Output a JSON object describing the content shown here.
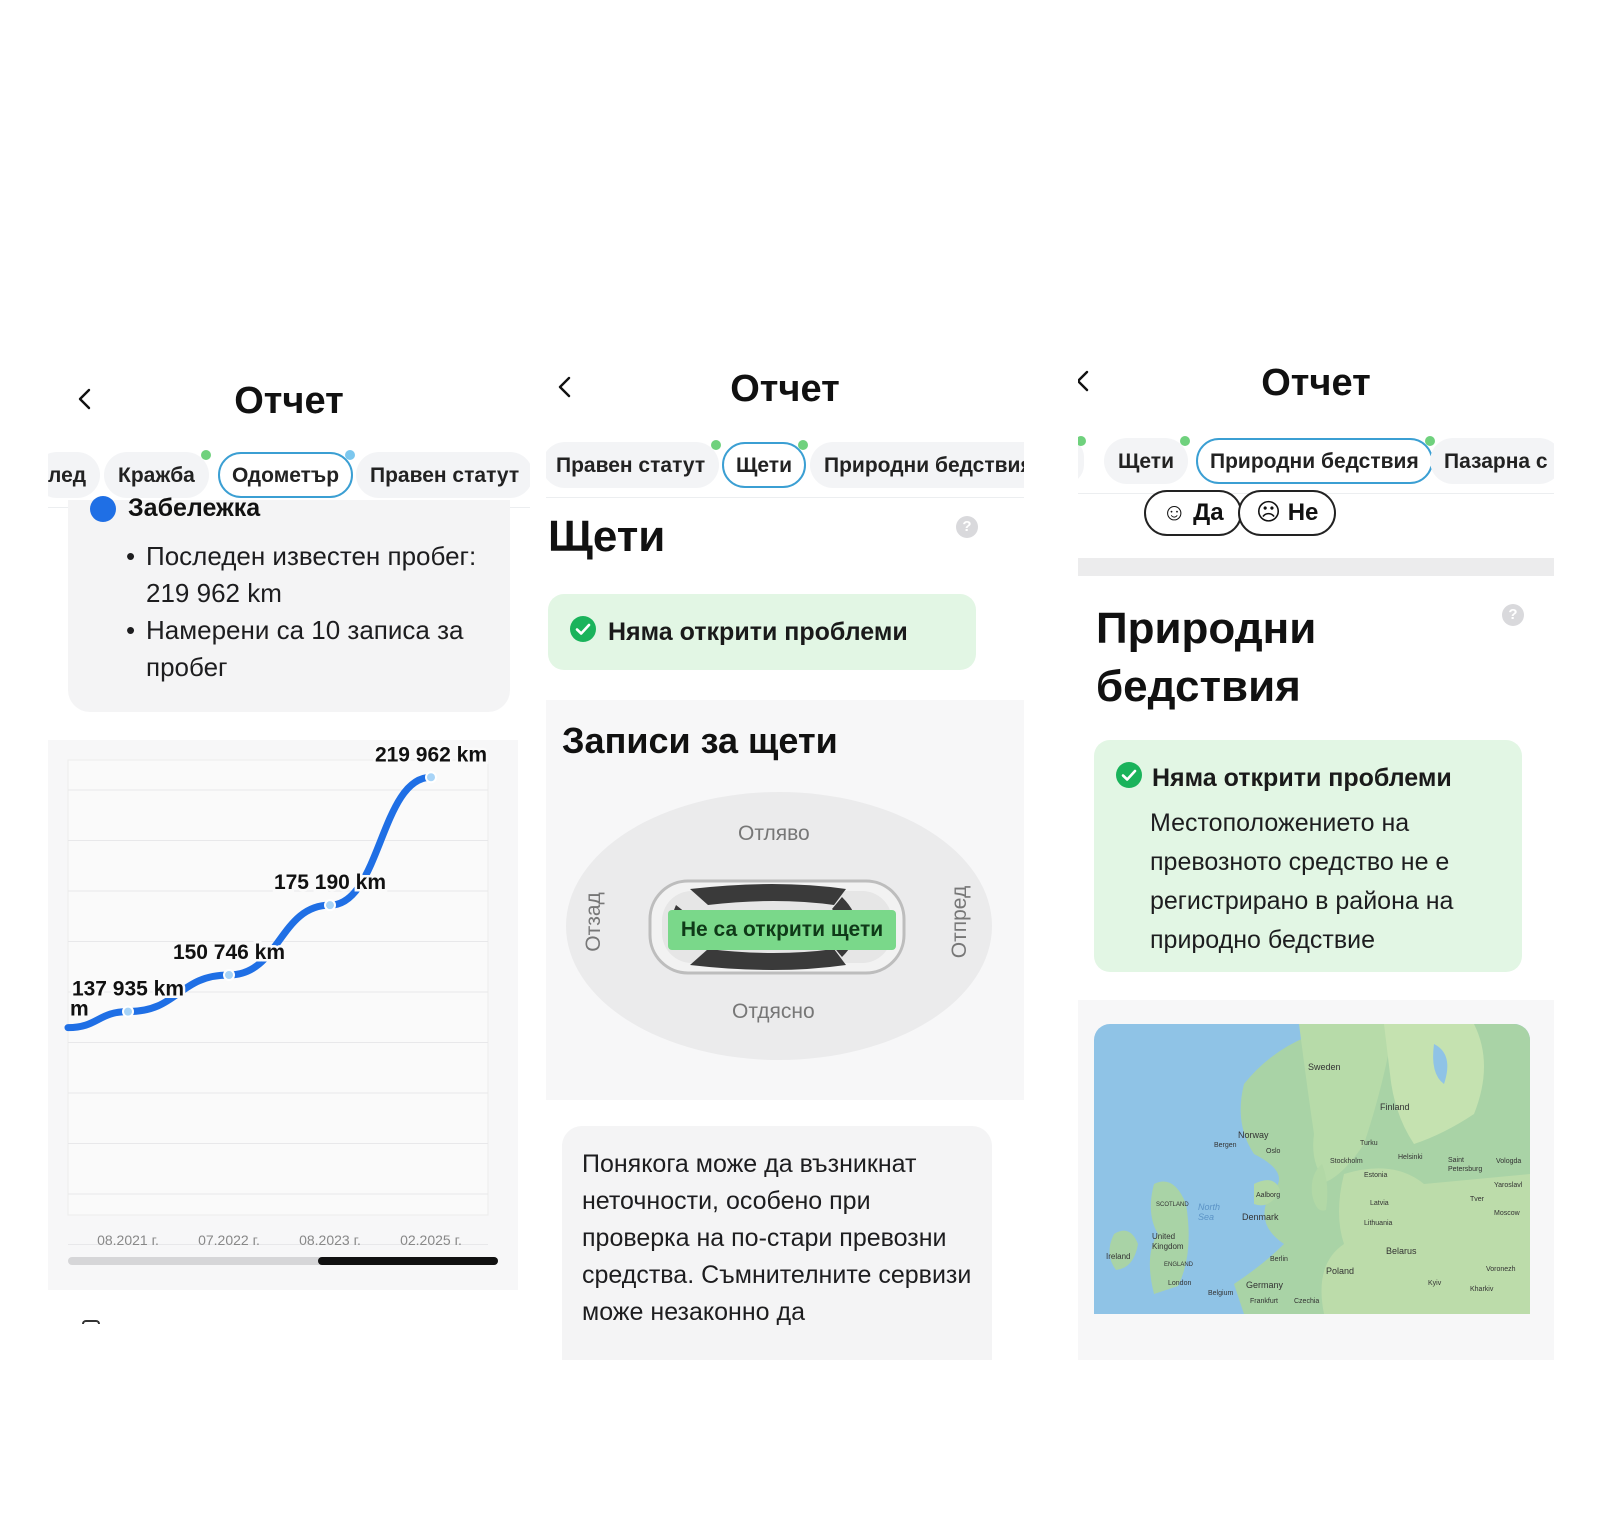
{
  "header": {
    "title": "Отчет"
  },
  "panel1": {
    "tabs": [
      {
        "label": "лед"
      },
      {
        "label": "Кражба"
      },
      {
        "label": "Одометър"
      },
      {
        "label": "Правен статут"
      }
    ],
    "note": {
      "title": "Забележка",
      "items": [
        "Последен известен пробег: 219 962 km",
        "Намерени са 10 записа за пробег"
      ]
    }
  },
  "chart_data": {
    "type": "line",
    "x": [
      "08.2021 г.",
      "07.2022 г.",
      "08.2023 г.",
      "02.2025 г."
    ],
    "series": [
      {
        "values": [
          137935,
          150746,
          175190,
          219962
        ],
        "labels": [
          "137 935 km",
          "150 746 km",
          "175 190 km",
          "219 962 km"
        ]
      }
    ],
    "partial_label": "m",
    "grid": true,
    "line_color": "#1f6fe5"
  },
  "panel2": {
    "tabs": [
      {
        "label": "Правен статут"
      },
      {
        "label": "Щети"
      },
      {
        "label": "Природни бедствия"
      }
    ],
    "section_title": "Щети",
    "status": "Няма открити проблеми",
    "records_title": "Записи за щети",
    "sides": {
      "left": "Отляво",
      "right": "Отдясно",
      "rear": "Отзад",
      "front": "Отпред"
    },
    "no_damage": "Не са открити щети",
    "disclaimer": "Понякога може да възникнат неточности, особено при проверка на по-стари превозни средства. Съмнителните сервизи може незаконно да"
  },
  "panel3": {
    "tabs": [
      {
        "label": "т"
      },
      {
        "label": "Щети"
      },
      {
        "label": "Природни бедствия"
      },
      {
        "label": "Пазарна с"
      }
    ],
    "yes": "☺ Да",
    "no": "☹ Не",
    "section_title_1": "Природни",
    "section_title_2": "бедствия",
    "status": "Няма открити проблеми",
    "status_text": "Местоположението на превозното средство не е регистрирано в района на природно бедствие",
    "map_labels": {
      "sweden": "Sweden",
      "finland": "Finland",
      "norway": "Norway",
      "bergen": "Bergen",
      "oslo": "Oslo",
      "turku": "Turku",
      "helsinki": "Helsinki",
      "stockholm": "Stockholm",
      "st_petersburg": "Saint Petersburg",
      "estonia": "Estonia",
      "latvia": "Latvia",
      "aalborg": "Aalborg",
      "denmark": "Denmark",
      "lithuania": "Lithuania",
      "scotland": "SCOTLAND",
      "north_sea": "North Sea",
      "uk": "United Kingdom",
      "ireland": "Ireland",
      "england": "ENGLAND",
      "london": "London",
      "berlin": "Berlin",
      "poland": "Poland",
      "belarus": "Belarus",
      "germany": "Germany",
      "belgium": "Belgium",
      "frankfurt": "Frankfurt",
      "czechia": "Czechia",
      "moscow": "Moscow",
      "tver": "Tver",
      "yaroslavl": "Yaroslavl",
      "vologda": "Vologda",
      "voronezh": "Voronezh",
      "kharkiv": "Kharkiv",
      "kyiv": "Kyiv"
    }
  },
  "colors": {
    "accent_tab_border": "#3b9fd3",
    "status_dot": "#6fd17d",
    "ok_background": "#e2f6e4",
    "check_green": "#1ab35b",
    "no_damage_badge": "#7ad88a"
  }
}
